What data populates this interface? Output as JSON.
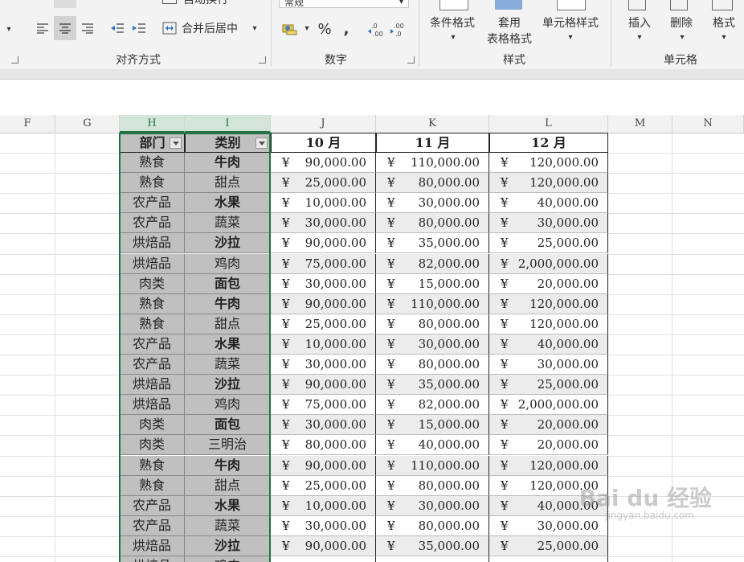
{
  "ribbon": {
    "align_group_label": "对齐方式",
    "number_group_label": "数字",
    "styles_group_label": "样式",
    "cells_group_label": "单元格",
    "wrap_text_label": "自动换行",
    "merge_center_label": "合并后居中",
    "number_format_value": "常规",
    "percent_symbol": "%",
    "comma_symbol": ",",
    "conditional_format_label": "条件格式",
    "table_format_label_1": "套用",
    "table_format_label_2": "表格格式",
    "cell_styles_label": "单元格样式",
    "insert_label": "插入",
    "delete_label": "删除",
    "format_label": "格式"
  },
  "columns": [
    "F",
    "G",
    "H",
    "I",
    "J",
    "K",
    "L",
    "M",
    "N"
  ],
  "table": {
    "headers": [
      "部门",
      "类别",
      "10 月",
      "11 月",
      "12 月"
    ],
    "currency": "¥",
    "rows": [
      {
        "dept": "熟食",
        "cat": "牛肉",
        "oct": "90,000.00",
        "nov": "110,000.00",
        "dec": "120,000.00",
        "bold": true
      },
      {
        "dept": "熟食",
        "cat": "甜点",
        "oct": "25,000.00",
        "nov": "80,000.00",
        "dec": "120,000.00",
        "bold": false
      },
      {
        "dept": "农产品",
        "cat": "水果",
        "oct": "10,000.00",
        "nov": "30,000.00",
        "dec": "40,000.00",
        "bold": true
      },
      {
        "dept": "农产品",
        "cat": "蔬菜",
        "oct": "30,000.00",
        "nov": "80,000.00",
        "dec": "30,000.00",
        "bold": false
      },
      {
        "dept": "烘焙品",
        "cat": "沙拉",
        "oct": "90,000.00",
        "nov": "35,000.00",
        "dec": "25,000.00",
        "bold": true
      },
      {
        "dept": "烘焙品",
        "cat": "鸡肉",
        "oct": "75,000.00",
        "nov": "82,000.00",
        "dec": "2,000,000.00",
        "bold": false
      },
      {
        "dept": "肉类",
        "cat": "面包",
        "oct": "30,000.00",
        "nov": "15,000.00",
        "dec": "20,000.00",
        "bold": true
      },
      {
        "dept": "熟食",
        "cat": "牛肉",
        "oct": "90,000.00",
        "nov": "110,000.00",
        "dec": "120,000.00",
        "bold": true
      },
      {
        "dept": "熟食",
        "cat": "甜点",
        "oct": "25,000.00",
        "nov": "80,000.00",
        "dec": "120,000.00",
        "bold": false
      },
      {
        "dept": "农产品",
        "cat": "水果",
        "oct": "10,000.00",
        "nov": "30,000.00",
        "dec": "40,000.00",
        "bold": true
      },
      {
        "dept": "农产品",
        "cat": "蔬菜",
        "oct": "30,000.00",
        "nov": "80,000.00",
        "dec": "30,000.00",
        "bold": false
      },
      {
        "dept": "烘焙品",
        "cat": "沙拉",
        "oct": "90,000.00",
        "nov": "35,000.00",
        "dec": "25,000.00",
        "bold": true
      },
      {
        "dept": "烘焙品",
        "cat": "鸡肉",
        "oct": "75,000.00",
        "nov": "82,000.00",
        "dec": "2,000,000.00",
        "bold": false
      },
      {
        "dept": "肉类",
        "cat": "面包",
        "oct": "30,000.00",
        "nov": "15,000.00",
        "dec": "20,000.00",
        "bold": true
      },
      {
        "dept": "肉类",
        "cat": "三明治",
        "oct": "80,000.00",
        "nov": "40,000.00",
        "dec": "20,000.00",
        "bold": false
      },
      {
        "dept": "熟食",
        "cat": "牛肉",
        "oct": "90,000.00",
        "nov": "110,000.00",
        "dec": "120,000.00",
        "bold": true
      },
      {
        "dept": "熟食",
        "cat": "甜点",
        "oct": "25,000.00",
        "nov": "80,000.00",
        "dec": "120,000.00",
        "bold": false
      },
      {
        "dept": "农产品",
        "cat": "水果",
        "oct": "10,000.00",
        "nov": "30,000.00",
        "dec": "40,000.00",
        "bold": true
      },
      {
        "dept": "农产品",
        "cat": "蔬菜",
        "oct": "30,000.00",
        "nov": "80,000.00",
        "dec": "30,000.00",
        "bold": false
      },
      {
        "dept": "烘焙品",
        "cat": "沙拉",
        "oct": "90,000.00",
        "nov": "35,000.00",
        "dec": "25,000.00",
        "bold": true
      },
      {
        "dept": "烘焙品",
        "cat": "鸡肉",
        "oct": "",
        "nov": "",
        "dec": "",
        "bold": false
      }
    ]
  },
  "watermark": {
    "text": "Bai du 经验",
    "sub": "jingyan.baidu.com"
  },
  "colors": {
    "accent": "#217346",
    "selected_fill": "#c0c0c0",
    "alt_row": "#ececec"
  }
}
